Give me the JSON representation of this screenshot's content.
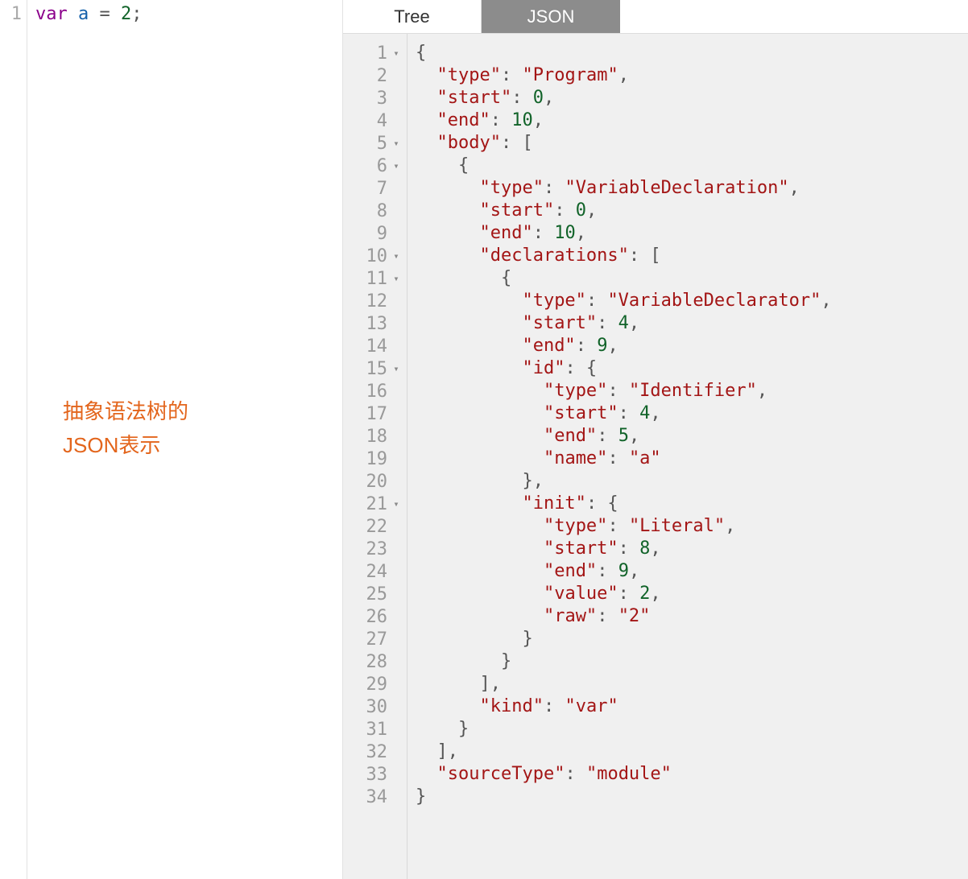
{
  "left": {
    "lineNumber": "1",
    "code": {
      "kw": "var",
      "ident": "a",
      "op": "=",
      "num": "2",
      "punc": ";"
    },
    "annotation_line1": "抽象语法树的",
    "annotation_line2": "JSON表示"
  },
  "tabs": {
    "tree": "Tree",
    "json": "JSON"
  },
  "jsonLines": [
    {
      "n": "1",
      "fold": "▾",
      "tokens": [
        [
          "jpunc",
          "{"
        ]
      ]
    },
    {
      "n": "2",
      "fold": "",
      "tokens": [
        [
          "indent",
          "  "
        ],
        [
          "jkey",
          "\"type\""
        ],
        [
          "jpunc",
          ": "
        ],
        [
          "jstr",
          "\"Program\""
        ],
        [
          "jpunc",
          ","
        ]
      ]
    },
    {
      "n": "3",
      "fold": "",
      "tokens": [
        [
          "indent",
          "  "
        ],
        [
          "jkey",
          "\"start\""
        ],
        [
          "jpunc",
          ": "
        ],
        [
          "jnum",
          "0"
        ],
        [
          "jpunc",
          ","
        ]
      ]
    },
    {
      "n": "4",
      "fold": "",
      "tokens": [
        [
          "indent",
          "  "
        ],
        [
          "jkey",
          "\"end\""
        ],
        [
          "jpunc",
          ": "
        ],
        [
          "jnum",
          "10"
        ],
        [
          "jpunc",
          ","
        ]
      ]
    },
    {
      "n": "5",
      "fold": "▾",
      "tokens": [
        [
          "indent",
          "  "
        ],
        [
          "jkey",
          "\"body\""
        ],
        [
          "jpunc",
          ": ["
        ]
      ]
    },
    {
      "n": "6",
      "fold": "▾",
      "tokens": [
        [
          "indent",
          "    "
        ],
        [
          "jpunc",
          "{"
        ]
      ]
    },
    {
      "n": "7",
      "fold": "",
      "tokens": [
        [
          "indent",
          "      "
        ],
        [
          "jkey",
          "\"type\""
        ],
        [
          "jpunc",
          ": "
        ],
        [
          "jstr",
          "\"VariableDeclaration\""
        ],
        [
          "jpunc",
          ","
        ]
      ]
    },
    {
      "n": "8",
      "fold": "",
      "tokens": [
        [
          "indent",
          "      "
        ],
        [
          "jkey",
          "\"start\""
        ],
        [
          "jpunc",
          ": "
        ],
        [
          "jnum",
          "0"
        ],
        [
          "jpunc",
          ","
        ]
      ]
    },
    {
      "n": "9",
      "fold": "",
      "tokens": [
        [
          "indent",
          "      "
        ],
        [
          "jkey",
          "\"end\""
        ],
        [
          "jpunc",
          ": "
        ],
        [
          "jnum",
          "10"
        ],
        [
          "jpunc",
          ","
        ]
      ]
    },
    {
      "n": "10",
      "fold": "▾",
      "tokens": [
        [
          "indent",
          "      "
        ],
        [
          "jkey",
          "\"declarations\""
        ],
        [
          "jpunc",
          ": ["
        ]
      ]
    },
    {
      "n": "11",
      "fold": "▾",
      "tokens": [
        [
          "indent",
          "        "
        ],
        [
          "jpunc",
          "{"
        ]
      ]
    },
    {
      "n": "12",
      "fold": "",
      "tokens": [
        [
          "indent",
          "          "
        ],
        [
          "jkey",
          "\"type\""
        ],
        [
          "jpunc",
          ": "
        ],
        [
          "jstr",
          "\"VariableDeclarator\""
        ],
        [
          "jpunc",
          ","
        ]
      ]
    },
    {
      "n": "13",
      "fold": "",
      "tokens": [
        [
          "indent",
          "          "
        ],
        [
          "jkey",
          "\"start\""
        ],
        [
          "jpunc",
          ": "
        ],
        [
          "jnum",
          "4"
        ],
        [
          "jpunc",
          ","
        ]
      ]
    },
    {
      "n": "14",
      "fold": "",
      "tokens": [
        [
          "indent",
          "          "
        ],
        [
          "jkey",
          "\"end\""
        ],
        [
          "jpunc",
          ": "
        ],
        [
          "jnum",
          "9"
        ],
        [
          "jpunc",
          ","
        ]
      ]
    },
    {
      "n": "15",
      "fold": "▾",
      "tokens": [
        [
          "indent",
          "          "
        ],
        [
          "jkey",
          "\"id\""
        ],
        [
          "jpunc",
          ": {"
        ]
      ]
    },
    {
      "n": "16",
      "fold": "",
      "tokens": [
        [
          "indent",
          "            "
        ],
        [
          "jkey",
          "\"type\""
        ],
        [
          "jpunc",
          ": "
        ],
        [
          "jstr",
          "\"Identifier\""
        ],
        [
          "jpunc",
          ","
        ]
      ]
    },
    {
      "n": "17",
      "fold": "",
      "tokens": [
        [
          "indent",
          "            "
        ],
        [
          "jkey",
          "\"start\""
        ],
        [
          "jpunc",
          ": "
        ],
        [
          "jnum",
          "4"
        ],
        [
          "jpunc",
          ","
        ]
      ]
    },
    {
      "n": "18",
      "fold": "",
      "tokens": [
        [
          "indent",
          "            "
        ],
        [
          "jkey",
          "\"end\""
        ],
        [
          "jpunc",
          ": "
        ],
        [
          "jnum",
          "5"
        ],
        [
          "jpunc",
          ","
        ]
      ]
    },
    {
      "n": "19",
      "fold": "",
      "tokens": [
        [
          "indent",
          "            "
        ],
        [
          "jkey",
          "\"name\""
        ],
        [
          "jpunc",
          ": "
        ],
        [
          "jstr",
          "\"a\""
        ]
      ]
    },
    {
      "n": "20",
      "fold": "",
      "tokens": [
        [
          "indent",
          "          "
        ],
        [
          "jpunc",
          "},"
        ]
      ]
    },
    {
      "n": "21",
      "fold": "▾",
      "tokens": [
        [
          "indent",
          "          "
        ],
        [
          "jkey",
          "\"init\""
        ],
        [
          "jpunc",
          ": {"
        ]
      ]
    },
    {
      "n": "22",
      "fold": "",
      "tokens": [
        [
          "indent",
          "            "
        ],
        [
          "jkey",
          "\"type\""
        ],
        [
          "jpunc",
          ": "
        ],
        [
          "jstr",
          "\"Literal\""
        ],
        [
          "jpunc",
          ","
        ]
      ]
    },
    {
      "n": "23",
      "fold": "",
      "tokens": [
        [
          "indent",
          "            "
        ],
        [
          "jkey",
          "\"start\""
        ],
        [
          "jpunc",
          ": "
        ],
        [
          "jnum",
          "8"
        ],
        [
          "jpunc",
          ","
        ]
      ]
    },
    {
      "n": "24",
      "fold": "",
      "tokens": [
        [
          "indent",
          "            "
        ],
        [
          "jkey",
          "\"end\""
        ],
        [
          "jpunc",
          ": "
        ],
        [
          "jnum",
          "9"
        ],
        [
          "jpunc",
          ","
        ]
      ]
    },
    {
      "n": "25",
      "fold": "",
      "tokens": [
        [
          "indent",
          "            "
        ],
        [
          "jkey",
          "\"value\""
        ],
        [
          "jpunc",
          ": "
        ],
        [
          "jnum",
          "2"
        ],
        [
          "jpunc",
          ","
        ]
      ]
    },
    {
      "n": "26",
      "fold": "",
      "tokens": [
        [
          "indent",
          "            "
        ],
        [
          "jkey",
          "\"raw\""
        ],
        [
          "jpunc",
          ": "
        ],
        [
          "jstr",
          "\"2\""
        ]
      ]
    },
    {
      "n": "27",
      "fold": "",
      "tokens": [
        [
          "indent",
          "          "
        ],
        [
          "jpunc",
          "}"
        ]
      ]
    },
    {
      "n": "28",
      "fold": "",
      "tokens": [
        [
          "indent",
          "        "
        ],
        [
          "jpunc",
          "}"
        ]
      ]
    },
    {
      "n": "29",
      "fold": "",
      "tokens": [
        [
          "indent",
          "      "
        ],
        [
          "jpunc",
          "],"
        ]
      ]
    },
    {
      "n": "30",
      "fold": "",
      "tokens": [
        [
          "indent",
          "      "
        ],
        [
          "jkey",
          "\"kind\""
        ],
        [
          "jpunc",
          ": "
        ],
        [
          "jstr",
          "\"var\""
        ]
      ]
    },
    {
      "n": "31",
      "fold": "",
      "tokens": [
        [
          "indent",
          "    "
        ],
        [
          "jpunc",
          "}"
        ]
      ]
    },
    {
      "n": "32",
      "fold": "",
      "tokens": [
        [
          "indent",
          "  "
        ],
        [
          "jpunc",
          "],"
        ]
      ]
    },
    {
      "n": "33",
      "fold": "",
      "tokens": [
        [
          "indent",
          "  "
        ],
        [
          "jkey",
          "\"sourceType\""
        ],
        [
          "jpunc",
          ": "
        ],
        [
          "jstr",
          "\"module\""
        ]
      ]
    },
    {
      "n": "34",
      "fold": "",
      "tokens": [
        [
          "jpunc",
          "}"
        ]
      ]
    }
  ]
}
